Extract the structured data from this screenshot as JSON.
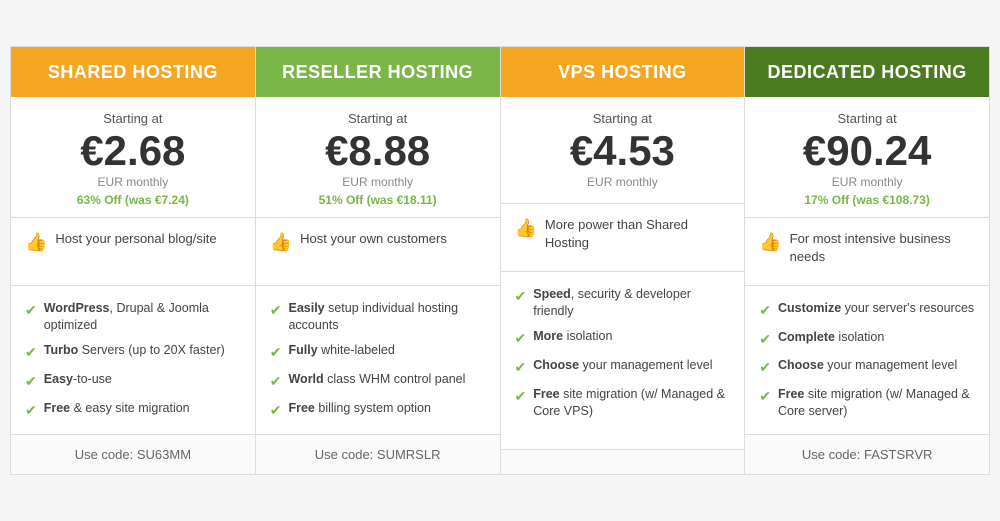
{
  "plans": [
    {
      "id": "shared",
      "header_label": "Shared Hosting",
      "header_class": "header-orange",
      "starting_at": "Starting at",
      "price": "€2.68",
      "eur_monthly": "EUR monthly",
      "discount": "63% Off",
      "was": "(was €7.24)",
      "highlight_text": "Host your personal blog/site",
      "features": [
        {
          "bold": "WordPress",
          "rest": ", Drupal & Joomla optimized"
        },
        {
          "bold": "Turbo",
          "rest": " Servers (up to 20X faster)"
        },
        {
          "bold": "Easy",
          "rest": "-to-use"
        },
        {
          "bold": "Free",
          "rest": " & easy site migration"
        }
      ],
      "promo": "Use code: SU63MM"
    },
    {
      "id": "reseller",
      "header_label": "Reseller Hosting",
      "header_class": "header-green",
      "starting_at": "Starting at",
      "price": "€8.88",
      "eur_monthly": "EUR monthly",
      "discount": "51% Off",
      "was": "(was €18.11)",
      "highlight_text": "Host your own customers",
      "features": [
        {
          "bold": "Easily",
          "rest": " setup individual hosting accounts"
        },
        {
          "bold": "Fully",
          "rest": " white-labeled"
        },
        {
          "bold": "World",
          "rest": " class WHM control panel"
        },
        {
          "bold": "Free",
          "rest": " billing system option"
        }
      ],
      "promo": "Use code: SUMRSLR"
    },
    {
      "id": "vps",
      "header_label": "VPS Hosting",
      "header_class": "header-orange",
      "starting_at": "Starting at",
      "price": "€4.53",
      "eur_monthly": "EUR monthly",
      "discount": "",
      "was": "",
      "highlight_text": "More power than Shared Hosting",
      "features": [
        {
          "bold": "Speed",
          "rest": ", security & developer friendly"
        },
        {
          "bold": "More",
          "rest": " isolation"
        },
        {
          "bold": "Choose",
          "rest": " your management level"
        },
        {
          "bold": "Free",
          "rest": " site migration (w/ Managed & Core VPS)"
        }
      ],
      "promo": ""
    },
    {
      "id": "dedicated",
      "header_label": "Dedicated Hosting",
      "header_class": "header-dark-green",
      "starting_at": "Starting at",
      "price": "€90.24",
      "eur_monthly": "EUR monthly",
      "discount": "17% Off",
      "was": "(was €108.73)",
      "highlight_text": "For most intensive business needs",
      "features": [
        {
          "bold": "Customize",
          "rest": " your server's resources"
        },
        {
          "bold": "Complete",
          "rest": " isolation"
        },
        {
          "bold": "Choose",
          "rest": " your management level"
        },
        {
          "bold": "Free",
          "rest": " site migration (w/ Managed & Core server)"
        }
      ],
      "promo": "Use code: FASTSRVR"
    }
  ]
}
